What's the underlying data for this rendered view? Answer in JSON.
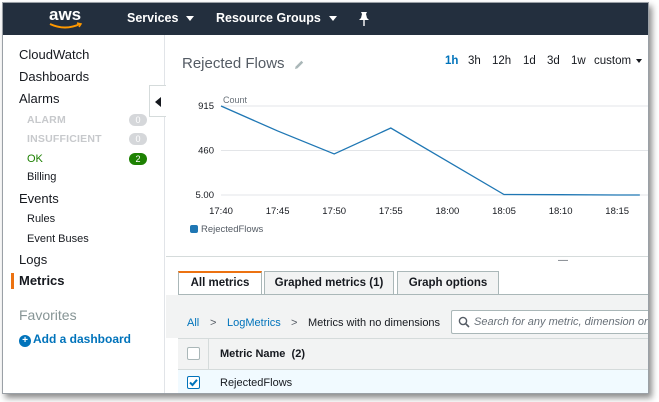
{
  "topnav": {
    "logo": "aws",
    "services": "Services",
    "resource_groups": "Resource Groups",
    "pin_icon": "pin-icon"
  },
  "sidebar": {
    "cloudwatch": "CloudWatch",
    "dashboards": "Dashboards",
    "alarms": "Alarms",
    "alarm_states": [
      {
        "label": "ALARM",
        "count": "0"
      },
      {
        "label": "INSUFFICIENT",
        "count": "0"
      },
      {
        "label": "OK",
        "count": "2"
      }
    ],
    "billing": "Billing",
    "events": "Events",
    "rules": "Rules",
    "event_buses": "Event Buses",
    "logs": "Logs",
    "metrics": "Metrics",
    "favorites": "Favorites",
    "add_dashboard": "Add a dashboard",
    "colors": {
      "active_bar": "#ec7211",
      "ok": "#1d8102",
      "link": "#0073bb"
    }
  },
  "chart_header": {
    "title": "Rejected Flows",
    "ranges": [
      "1h",
      "3h",
      "12h",
      "1d",
      "3d",
      "1w"
    ],
    "active_range": "1h",
    "custom": "custom"
  },
  "chart_data": {
    "type": "line",
    "ylabel": "Count",
    "y_ticks": [
      "915",
      "460",
      "5.00"
    ],
    "ylim": [
      5,
      915
    ],
    "x_ticks": [
      "17:40",
      "17:45",
      "17:50",
      "17:55",
      "18:00",
      "18:05",
      "18:10",
      "18:15"
    ],
    "series": [
      {
        "name": "RejectedFlows",
        "color": "#1f77b4",
        "points": [
          {
            "x": "17:40",
            "y": 915
          },
          {
            "x": "17:45",
            "y": 660
          },
          {
            "x": "17:50",
            "y": 425
          },
          {
            "x": "17:55",
            "y": 690
          },
          {
            "x": "18:05",
            "y": 10
          },
          {
            "x": "18:10",
            "y": 8
          },
          {
            "x": "18:15",
            "y": 5
          },
          {
            "x": "18:17",
            "y": 5
          }
        ]
      }
    ],
    "grid": true
  },
  "tabs": [
    {
      "label": "All metrics",
      "active": true
    },
    {
      "label": "Graphed metrics (1)",
      "active": false
    },
    {
      "label": "Graph options",
      "active": false
    }
  ],
  "breadcrumb": {
    "all": "All",
    "sep": ">",
    "namespace": "LogMetrics",
    "current": "Metrics with no dimensions"
  },
  "search": {
    "placeholder": "Search for any metric, dimension or"
  },
  "table": {
    "header": "Metric Name",
    "header_count": "(2)",
    "rows": [
      {
        "name": "RejectedFlows",
        "checked": true
      }
    ]
  }
}
